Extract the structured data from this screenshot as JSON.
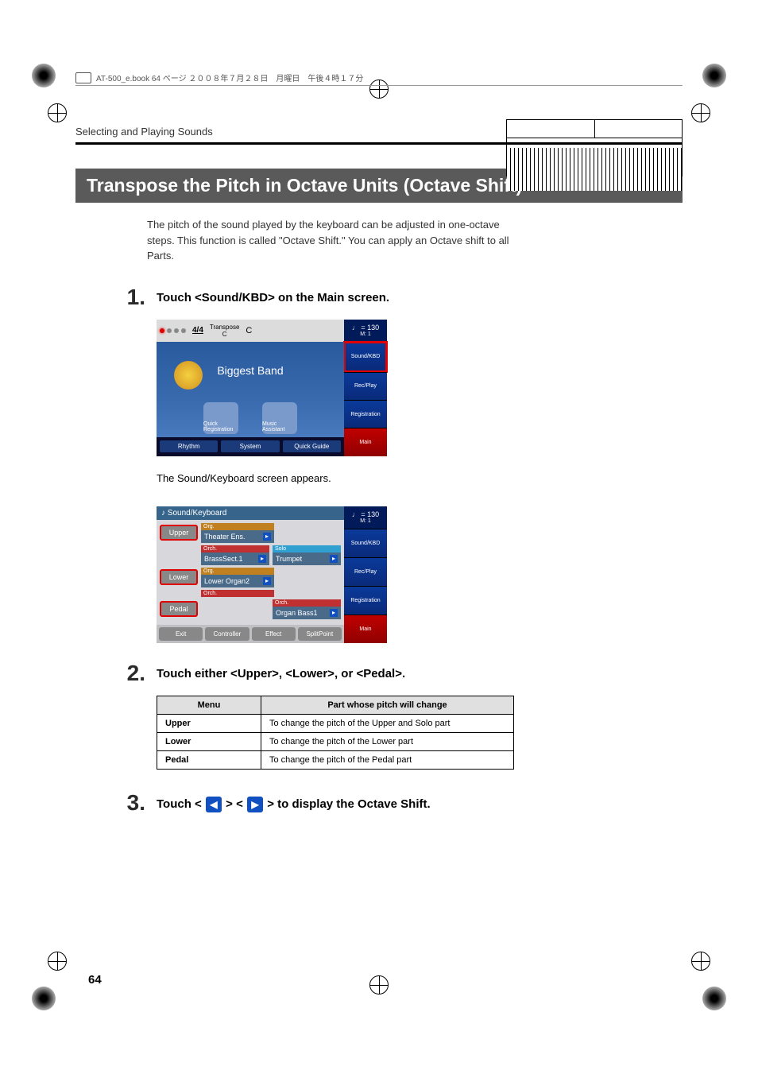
{
  "header_book_info": "AT-500_e.book  64 ページ  ２００８年７月２８日　月曜日　午後４時１７分",
  "breadcrumb": "Selecting and Playing Sounds",
  "section_title": "Transpose the Pitch in Octave Units (Octave Shift)",
  "intro": "The pitch of the sound played by the keyboard can be adjusted in one-octave steps. This function is called \"Octave Shift.\" You can apply an Octave shift to all Parts.",
  "steps": [
    {
      "num": "1.",
      "text": "Touch <Sound/KBD> on the Main screen."
    },
    {
      "num": "2.",
      "text": "Touch either <Upper>, <Lower>, or <Pedal>."
    },
    {
      "num": "3.",
      "text_pre": "Touch <",
      "text_mid": "> <",
      "text_post": "> to display the Octave Shift."
    }
  ],
  "step1_followup": "The Sound/Keyboard screen appears.",
  "screenshot1": {
    "time_sig": "4/4",
    "transpose_label": "Transpose",
    "transpose_val": "C",
    "tempo": "= 130",
    "measure": "M:    1",
    "main_display": "Biggest Band",
    "quick_reg": "Quick Registration",
    "music_asst": "Music Assistant",
    "bottom_buttons": [
      "Rhythm",
      "System",
      "Quick Guide"
    ],
    "side_buttons": [
      "Sound/KBD",
      "Rec/Play",
      "Registration",
      "Main"
    ]
  },
  "screenshot2": {
    "title": "Sound/Keyboard",
    "tempo": "= 130",
    "measure": "M:    1",
    "parts": [
      {
        "name": "Upper",
        "voices": [
          {
            "cat": "Org.",
            "cat_class": "org",
            "name": "Theater Ens."
          },
          {
            "cat": "Orch.",
            "cat_class": "orch",
            "name": "BrassSect.1"
          }
        ],
        "solo": {
          "cat": "Solo",
          "cat_class": "solo",
          "name": "Trumpet"
        }
      },
      {
        "name": "Lower",
        "voices": [
          {
            "cat": "Org.",
            "cat_class": "org",
            "name": "Lower Organ2"
          },
          {
            "cat": "Orch.",
            "cat_class": "orch",
            "name": ""
          }
        ]
      },
      {
        "name": "Pedal",
        "voices": [],
        "solo": {
          "cat": "Orch.",
          "cat_class": "orch",
          "name": "Organ Bass1"
        }
      }
    ],
    "bottom_buttons": [
      "Exit",
      "Controller",
      "Effect",
      "SplitPoint"
    ],
    "side_buttons": [
      "Sound/KBD",
      "Rec/Play",
      "Registration",
      "Main"
    ]
  },
  "table": {
    "headers": [
      "Menu",
      "Part whose pitch will change"
    ],
    "rows": [
      [
        "Upper",
        "To change the pitch of the Upper and Solo part"
      ],
      [
        "Lower",
        "To change the pitch of the Lower part"
      ],
      [
        "Pedal",
        "To change the pitch of the Pedal part"
      ]
    ]
  },
  "page_number": "64"
}
